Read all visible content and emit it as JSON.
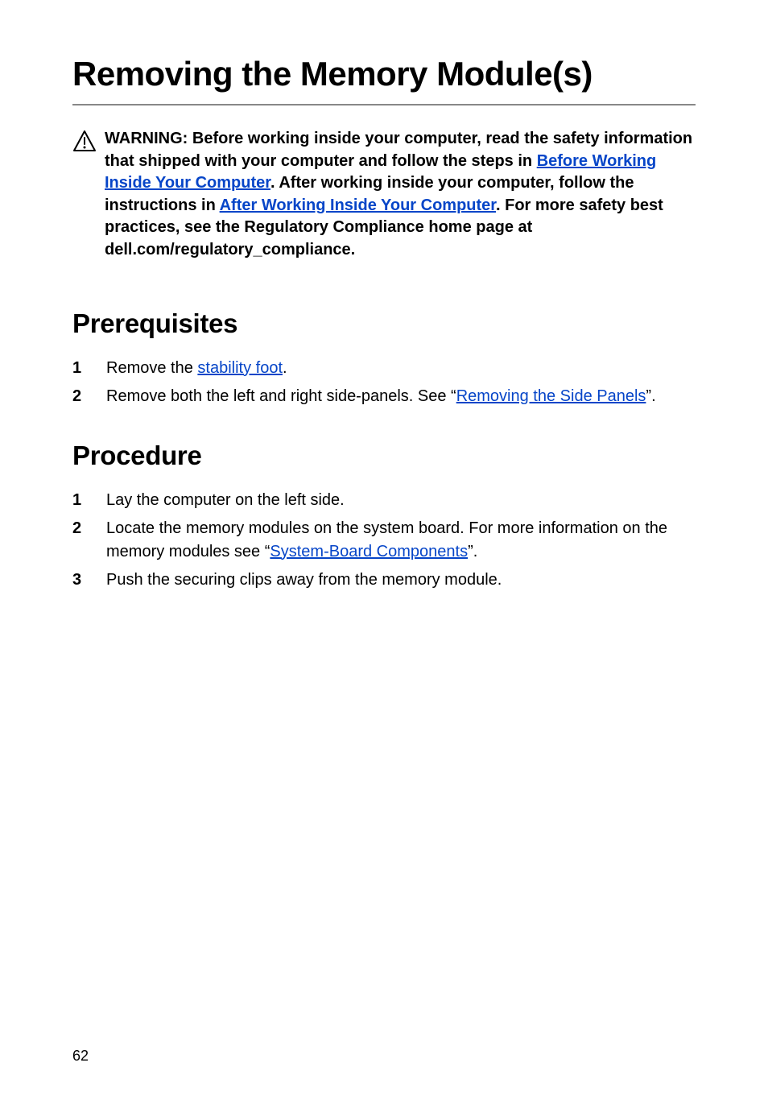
{
  "title": "Removing the Memory Module(s)",
  "warning": {
    "prefix": "WARNING: Before working inside your computer, read the safety information that shipped with your computer and follow the steps in ",
    "link1_text": "Before Working Inside Your Computer",
    "mid1": ". After working inside your computer, follow the instructions in ",
    "link2_text": "After Working Inside Your Computer",
    "suffix": ". For more safety best practices, see the Regulatory Compliance home page at dell.com/regulatory_compliance."
  },
  "sections": {
    "prerequisites": {
      "heading": "Prerequisites",
      "items": [
        {
          "pre": "Remove the ",
          "link": "stability foot",
          "post": "."
        },
        {
          "pre": "Remove both the left and right side-panels. See “",
          "link": "Removing the Side Panels",
          "post": "”."
        }
      ]
    },
    "procedure": {
      "heading": "Procedure",
      "items": [
        {
          "pre": "Lay the computer on the left side.",
          "link": "",
          "post": ""
        },
        {
          "pre": "Locate the memory modules on the system board. For more information on the memory modules see “",
          "link": "System-Board Components",
          "post": "”."
        },
        {
          "pre": "Push the securing clips away from the memory module.",
          "link": "",
          "post": ""
        }
      ]
    }
  },
  "page_number": "62"
}
